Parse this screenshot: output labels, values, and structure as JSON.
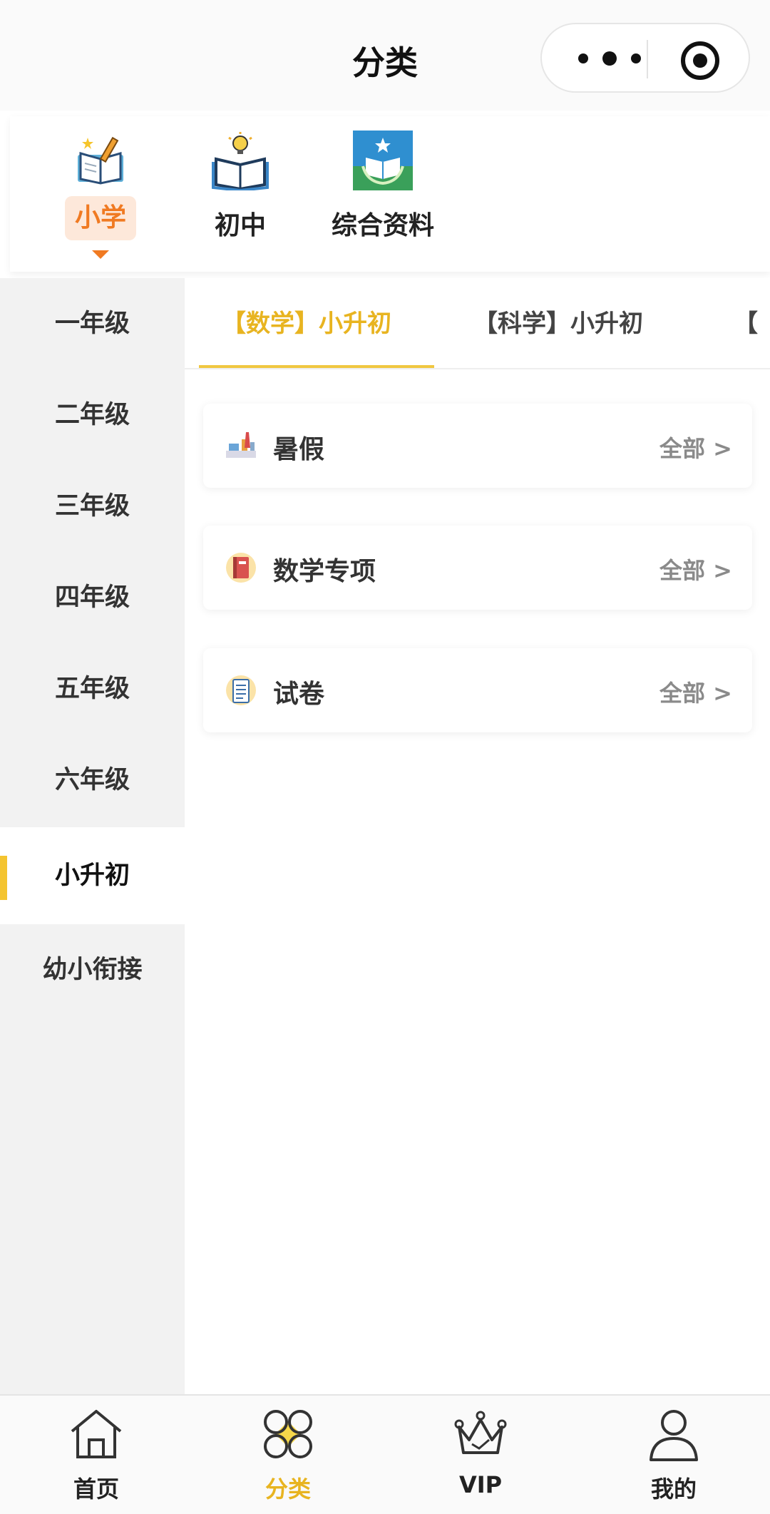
{
  "nav": {
    "title": "分类"
  },
  "top_categories": [
    {
      "label": "小学",
      "icon": "pencil-book-icon",
      "active": true
    },
    {
      "label": "初中",
      "icon": "lightbulb-book-icon",
      "active": false
    },
    {
      "label": "综合资料",
      "icon": "star-book-icon",
      "active": false
    }
  ],
  "sidebar": {
    "items": [
      {
        "label": "一年级"
      },
      {
        "label": "二年级"
      },
      {
        "label": "三年级"
      },
      {
        "label": "四年级"
      },
      {
        "label": "五年级"
      },
      {
        "label": "六年级"
      },
      {
        "label": "小升初"
      },
      {
        "label": "幼小衔接"
      }
    ],
    "active_index": 6
  },
  "tabs": [
    {
      "label": "【数学】小升初",
      "active": true
    },
    {
      "label": "【科学】小升初",
      "active": false
    },
    {
      "label": "【"
    }
  ],
  "cards": [
    {
      "title": "暑假",
      "more": "全部 >",
      "icon": "desk-stationery-icon"
    },
    {
      "title": "数学专项",
      "more": "全部 >",
      "icon": "red-book-icon"
    },
    {
      "title": "试卷",
      "more": "全部 >",
      "icon": "notepad-icon"
    }
  ],
  "tabbar": {
    "items": [
      {
        "label": "首页",
        "icon": "home-icon"
      },
      {
        "label": "分类",
        "icon": "category-icon",
        "active": true
      },
      {
        "label": "VIP",
        "icon": "crown-icon"
      },
      {
        "label": "我的",
        "icon": "user-icon"
      }
    ]
  },
  "colors": {
    "accent_yellow": "#f0c740",
    "accent_orange": "#f07a22",
    "sidebar_bg": "#f2f2f2"
  }
}
